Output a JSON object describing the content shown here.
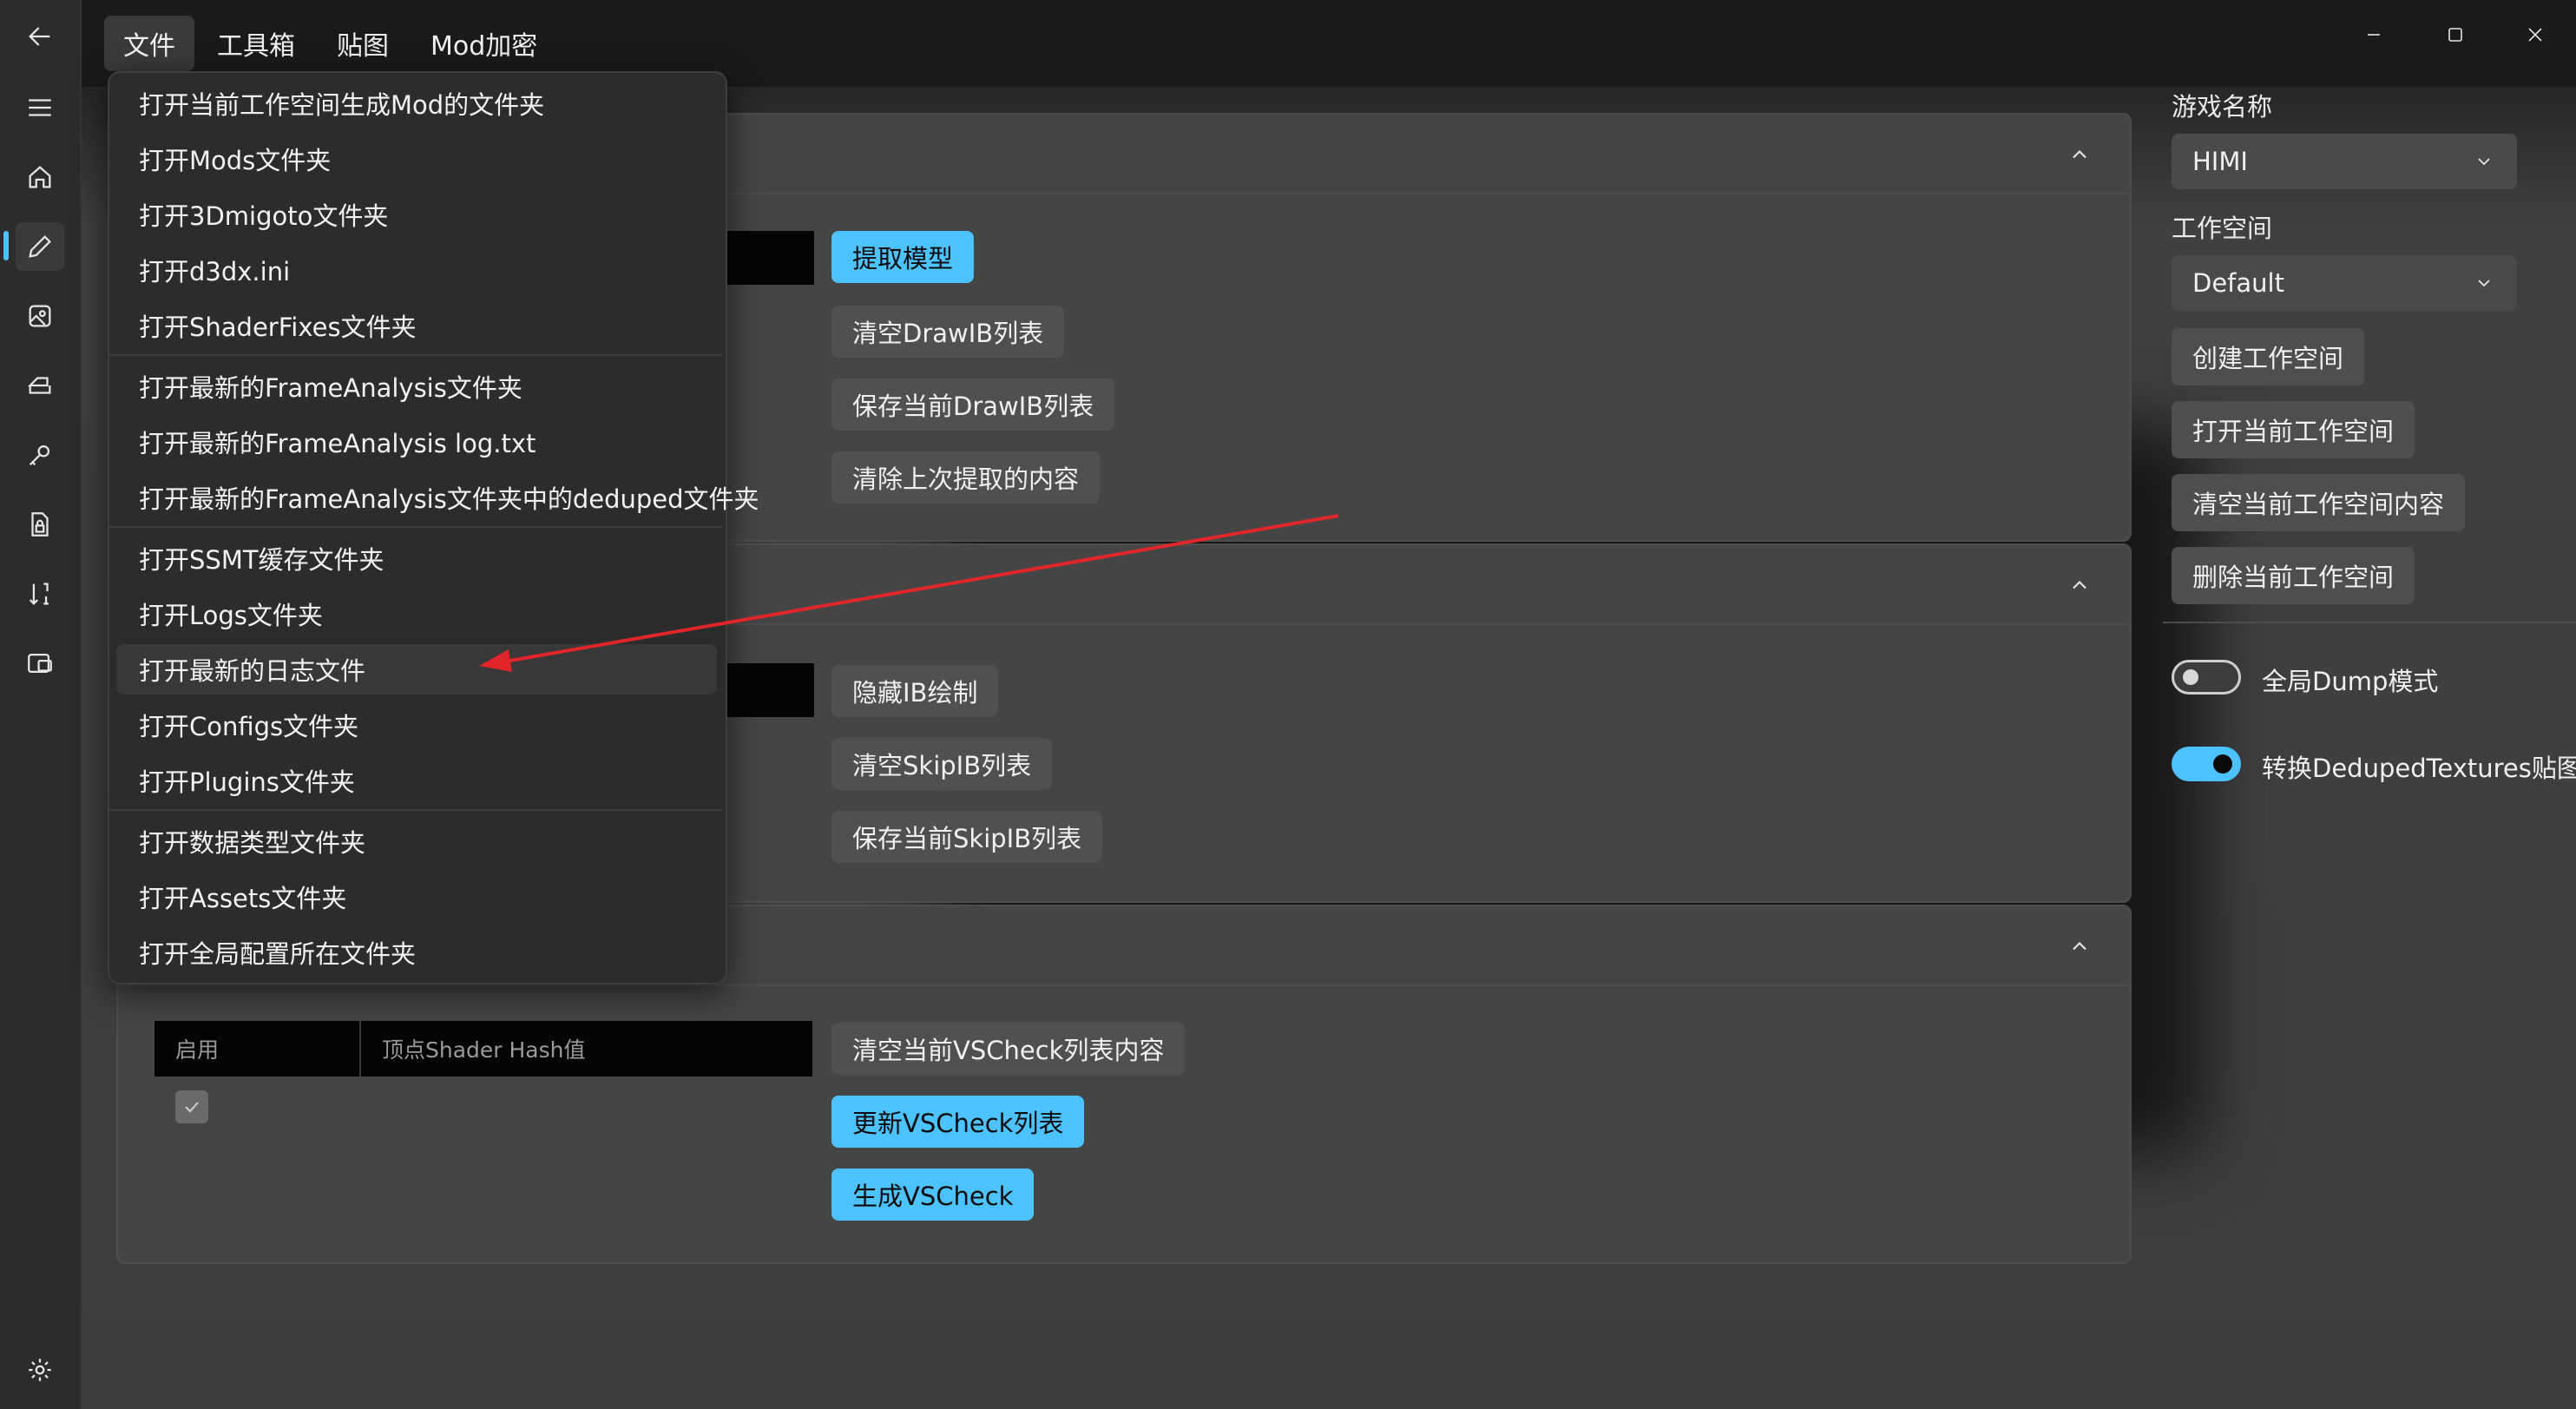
{
  "window": {
    "back_icon": "back-arrow-icon",
    "controls": [
      "minimize-icon",
      "maximize-icon",
      "close-icon"
    ]
  },
  "menubar": {
    "items": [
      {
        "label": "文件"
      },
      {
        "label": "工具箱"
      },
      {
        "label": "贴图"
      },
      {
        "label": "Mod加密"
      }
    ]
  },
  "sidebar": {
    "items": [
      "hamburger-icon",
      "home-icon",
      "pencil-icon",
      "image-icon",
      "print-icon",
      "key-icon",
      "file-lock-icon",
      "sort-icon",
      "texture-icon"
    ],
    "settings_icon": "gear-icon"
  },
  "file_menu": {
    "groups": [
      [
        "打开当前工作空间生成Mod的文件夹",
        "打开Mods文件夹",
        "打开3Dmigoto文件夹",
        "打开d3dx.ini",
        "打开ShaderFixes文件夹"
      ],
      [
        "打开最新的FrameAnalysis文件夹",
        "打开最新的FrameAnalysis log.txt",
        "打开最新的FrameAnalysis文件夹中的deduped文件夹"
      ],
      [
        "打开SSMT缓存文件夹",
        "打开Logs文件夹",
        "打开最新的日志文件",
        "打开Configs文件夹",
        "打开Plugins文件夹"
      ],
      [
        "打开数据类型文件夹",
        "打开Assets文件夹",
        "打开全局配置所在文件夹"
      ]
    ],
    "highlighted": "打开最新的日志文件"
  },
  "section1": {
    "buttons": [
      "提取模型",
      "清空DrawIB列表",
      "保存当前DrawIB列表",
      "清除上次提取的内容"
    ]
  },
  "section2": {
    "buttons": [
      "隐藏IB绘制",
      "清空SkipIB列表",
      "保存当前SkipIB列表"
    ]
  },
  "section3": {
    "table_headers": [
      "启用",
      "顶点Shader Hash值"
    ],
    "buttons": [
      "清空当前VSCheck列表内容",
      "更新VSCheck列表",
      "生成VSCheck"
    ]
  },
  "right_panel": {
    "game_name_label": "游戏名称",
    "game_name_value": "HIMI",
    "workspace_label": "工作空间",
    "workspace_value": "Default",
    "buttons": [
      "创建工作空间",
      "打开当前工作空间",
      "清空当前工作空间内容",
      "删除当前工作空间"
    ],
    "toggles": [
      {
        "label": "全局Dump模式",
        "on": false
      },
      {
        "label": "转换DedupedTextures贴图",
        "on": true
      }
    ]
  },
  "colors": {
    "accent": "#4cc2ff",
    "arrow": "#e0252b"
  }
}
